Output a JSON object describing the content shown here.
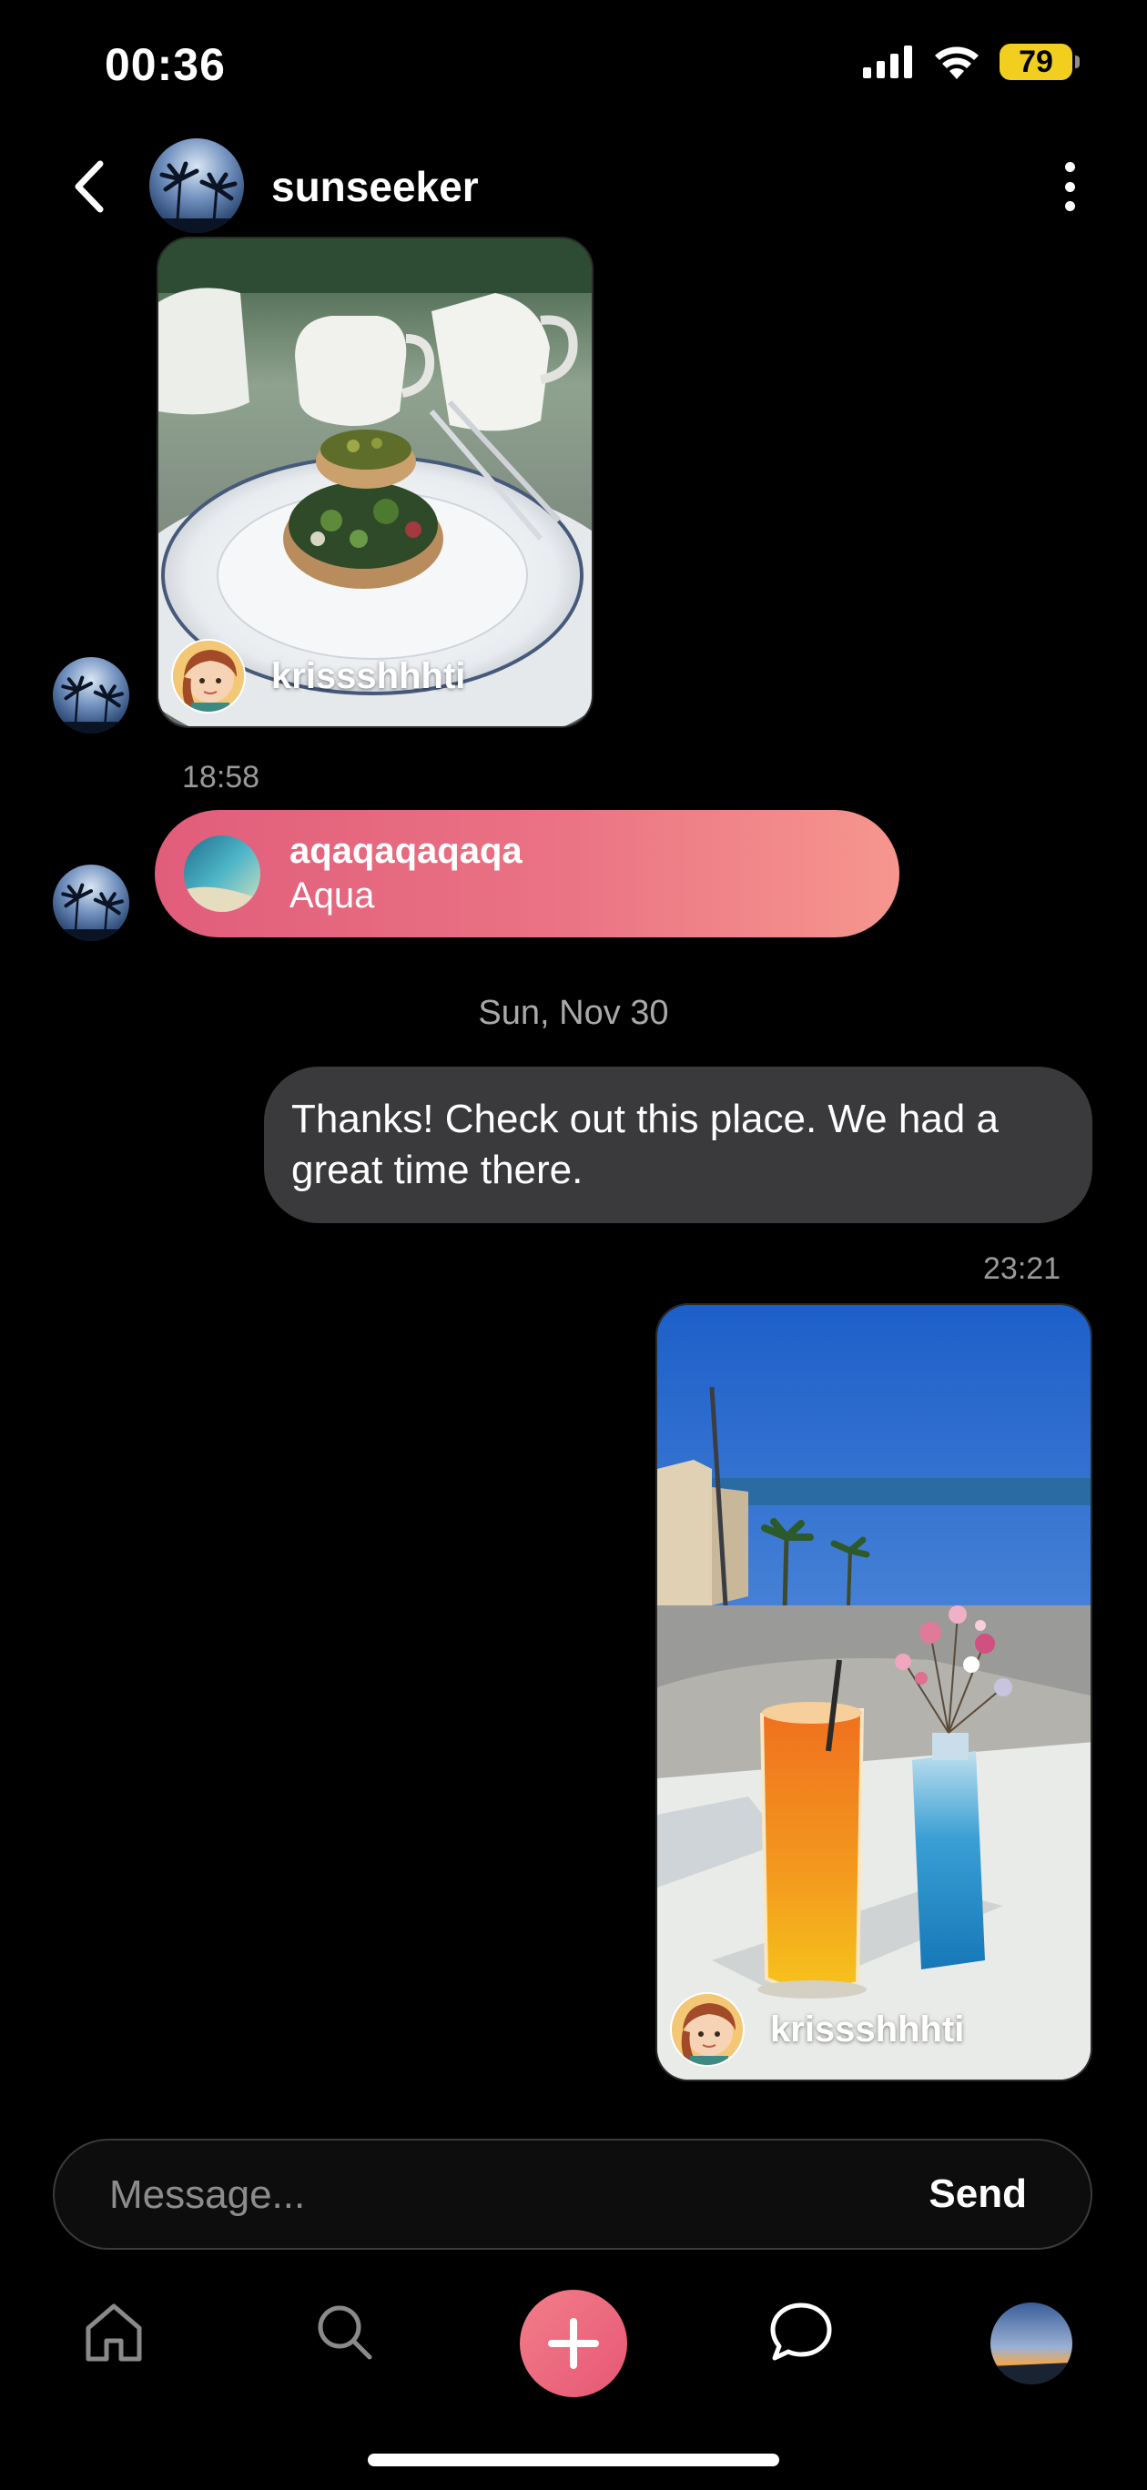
{
  "status_bar": {
    "time": "00:36",
    "battery": "79"
  },
  "header": {
    "username": "sunseeker"
  },
  "messages": {
    "first_card": {
      "owner": "krissshhhti"
    },
    "time_1": "18:58",
    "profile_share": {
      "title": "aqaqaqaqaqa",
      "subtitle": "Aqua"
    },
    "date_separator": "Sun, Nov 30",
    "text_message": "Thanks! Check out this place. We had a great time there.",
    "time_2": "23:21",
    "second_card": {
      "owner": "krissshhhti"
    }
  },
  "composer": {
    "placeholder": "Message...",
    "send_label": "Send"
  },
  "nav": {
    "items": [
      "home-icon",
      "search-icon",
      "create-icon",
      "messages-icon",
      "profile-avatar"
    ]
  },
  "colors": {
    "accent": "#e65774",
    "bubble_gray": "#3a3a3c",
    "battery": "#f2cf1e"
  }
}
